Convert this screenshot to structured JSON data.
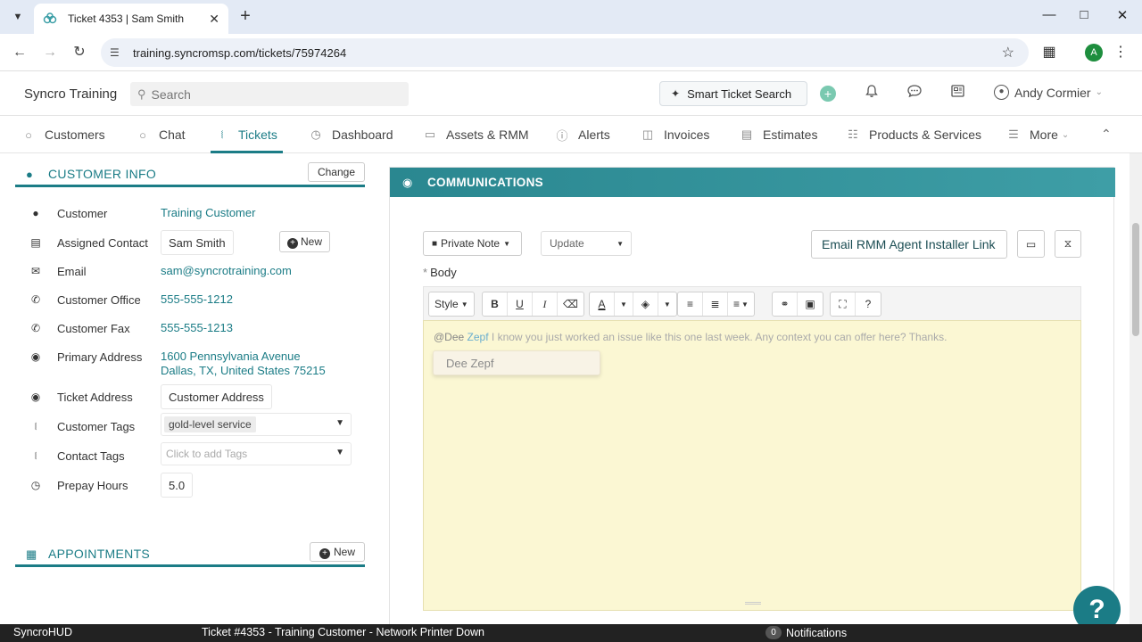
{
  "browser": {
    "tab_title": "Ticket 4353 | Sam Smith",
    "url": "training.syncromsp.com/tickets/75974264",
    "profile_initial": "A"
  },
  "header": {
    "brand": "Syncro Training",
    "search_placeholder": "Search",
    "smart_search_label": "Smart Ticket Search",
    "user_name": "Andy Cormier"
  },
  "nav": {
    "items": [
      {
        "label": "Customers",
        "icon": "person-icon"
      },
      {
        "label": "Chat",
        "icon": "chat-icon"
      },
      {
        "label": "Tickets",
        "icon": "tag-icon"
      },
      {
        "label": "Dashboard",
        "icon": "dashboard-icon"
      },
      {
        "label": "Assets & RMM",
        "icon": "monitor-icon"
      },
      {
        "label": "Alerts",
        "icon": "alert-icon"
      },
      {
        "label": "Invoices",
        "icon": "cart-icon"
      },
      {
        "label": "Estimates",
        "icon": "document-icon"
      },
      {
        "label": "Products & Services",
        "icon": "barcode-icon"
      },
      {
        "label": "More",
        "icon": "hamburger-icon"
      }
    ]
  },
  "customer_info": {
    "title": "CUSTOMER INFO",
    "change_label": "Change",
    "rows": {
      "customer": {
        "label": "Customer",
        "value": "Training Customer"
      },
      "assigned_contact": {
        "label": "Assigned Contact",
        "value": "Sam Smith",
        "new_label": "New"
      },
      "email": {
        "label": "Email",
        "value": "sam@syncrotraining.com"
      },
      "office": {
        "label": "Customer Office",
        "value": "555-555-1212"
      },
      "fax": {
        "label": "Customer Fax",
        "value": "555-555-1213"
      },
      "primary_address": {
        "label": "Primary Address",
        "line1": "1600 Pennsylvania Avenue",
        "line2": "Dallas, TX, United States 75215"
      },
      "ticket_address": {
        "label": "Ticket Address",
        "value": "Customer Address"
      },
      "customer_tags": {
        "label": "Customer Tags",
        "value": "gold-level service"
      },
      "contact_tags": {
        "label": "Contact Tags",
        "placeholder": "Click to add Tags"
      },
      "prepay_hours": {
        "label": "Prepay Hours",
        "value": "5.0"
      }
    }
  },
  "appointments": {
    "title": "APPOINTMENTS",
    "new_label": "New"
  },
  "communications": {
    "title": "COMMUNICATIONS",
    "note_type": "Private Note",
    "update_select": "Update",
    "email_rmm_label": "Email RMM Agent Installer Link",
    "body_label": "Body",
    "toolbar_style": "Style",
    "editor_at": "@Dee",
    "editor_mention": "Zepf",
    "editor_text": "I know you just worked an issue like this one last week. Any context you can offer here? Thanks.",
    "suggestion": "Dee Zepf"
  },
  "statusbar": {
    "app": "SyncroHUD",
    "ticket": "Ticket #4353 - Training Customer - Network Printer Down",
    "notif_count": "0",
    "notif_label": "Notifications"
  },
  "colors": {
    "accent": "#1b7c86",
    "editor_bg": "#fbf7d3",
    "status_bar": "#222222"
  }
}
